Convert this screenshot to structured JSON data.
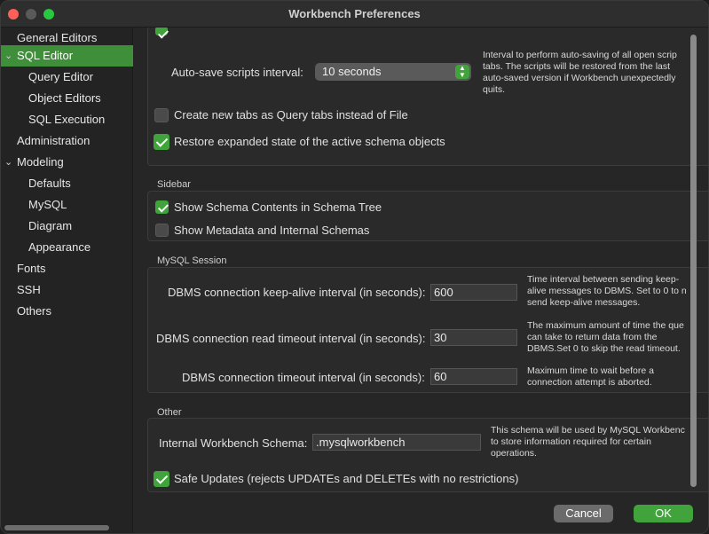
{
  "window": {
    "title": "Workbench Preferences"
  },
  "sidebar": {
    "items": [
      {
        "label": "General Editors",
        "level": 0
      },
      {
        "label": "SQL Editor",
        "level": 0,
        "selected": true,
        "expanded": true
      },
      {
        "label": "Query Editor",
        "level": 1
      },
      {
        "label": "Object Editors",
        "level": 1
      },
      {
        "label": "SQL Execution",
        "level": 1
      },
      {
        "label": "Administration",
        "level": 0
      },
      {
        "label": "Modeling",
        "level": 0,
        "expanded": true
      },
      {
        "label": "Defaults",
        "level": 1
      },
      {
        "label": "MySQL",
        "level": 1
      },
      {
        "label": "Diagram",
        "level": 1
      },
      {
        "label": "Appearance",
        "level": 1
      },
      {
        "label": "Fonts",
        "level": 0
      },
      {
        "label": "SSH",
        "level": 0
      },
      {
        "label": "Others",
        "level": 0
      }
    ]
  },
  "general": {
    "autosave_label": "Auto-save scripts interval:",
    "autosave_value": "10 seconds",
    "autosave_help": "Interval to perform auto-saving of all open scrip\ntabs. The scripts will be restored from the last\nauto-saved version if Workbench unexpectedly\nquits.",
    "query_tabs_label": "Create new tabs as Query tabs instead of File",
    "query_tabs_checked": false,
    "restore_label": "Restore expanded state of the active schema objects",
    "restore_checked": true
  },
  "sidebar_section": {
    "title": "Sidebar",
    "schema_contents_label": "Show Schema Contents in Schema Tree",
    "schema_contents_checked": true,
    "metadata_label": "Show Metadata and Internal Schemas",
    "metadata_checked": false
  },
  "session": {
    "title": "MySQL Session",
    "keepalive_label": "DBMS connection keep-alive interval (in seconds):",
    "keepalive_value": "600",
    "keepalive_help": "Time interval between sending keep-\nalive messages to DBMS. Set to 0 to n\nsend keep-alive messages.",
    "read_timeout_label": "DBMS connection read timeout interval (in seconds):",
    "read_timeout_value": "30",
    "read_timeout_help": "The maximum amount of time the que\ncan take to return data from the\nDBMS.Set 0 to skip the read timeout.",
    "conn_timeout_label": "DBMS connection timeout interval (in seconds):",
    "conn_timeout_value": "60",
    "conn_timeout_help": "Maximum time to wait before a\nconnection attempt is aborted."
  },
  "other": {
    "title": "Other",
    "schema_label": "Internal Workbench Schema:",
    "schema_value": ".mysqlworkbench",
    "schema_help": "This schema will be used by MySQL Workbenc\nto store information required for certain\noperations.",
    "safe_updates_label": "Safe Updates (rejects UPDATEs and DELETEs with no restrictions)",
    "safe_updates_checked": true
  },
  "buttons": {
    "cancel": "Cancel",
    "ok": "OK"
  },
  "colors": {
    "accent": "#41a33b",
    "selection": "#3f8f3a",
    "close": "#fe5f57",
    "zoom": "#28c840"
  }
}
